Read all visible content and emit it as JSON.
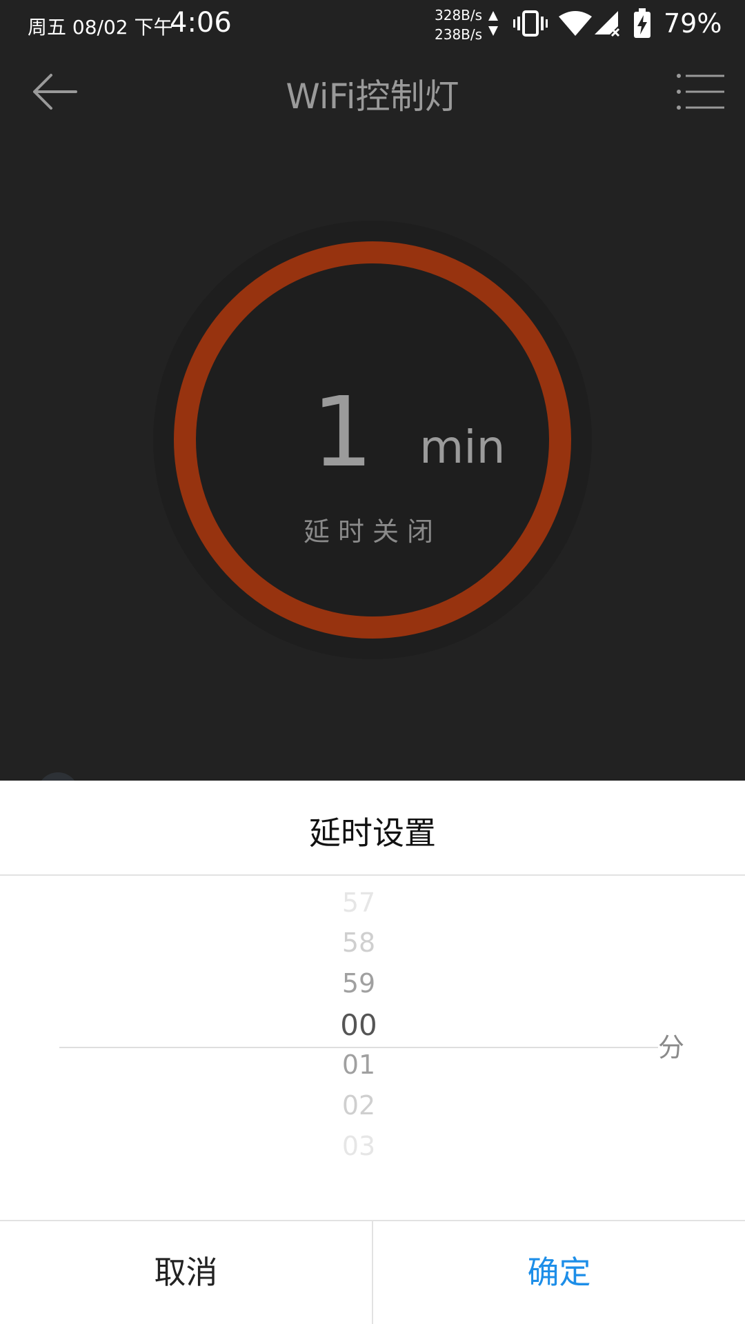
{
  "status_bar": {
    "date": "周五 08/02 下午",
    "time": "4:06",
    "net_up": "328B/s",
    "net_down": "238B/s",
    "battery": "79%"
  },
  "app_bar": {
    "title": "WiFi控制灯"
  },
  "timer": {
    "value": "1",
    "unit": "min",
    "caption": "延时关闭",
    "ring_color": "#97330f"
  },
  "sheet": {
    "title": "延时设置",
    "picker": {
      "items": [
        "57",
        "58",
        "59",
        "00",
        "01",
        "02",
        "03"
      ],
      "selected": "00",
      "unit": "分"
    },
    "cancel_label": "取消",
    "confirm_label": "确定",
    "confirm_color": "#1d8ee8"
  }
}
